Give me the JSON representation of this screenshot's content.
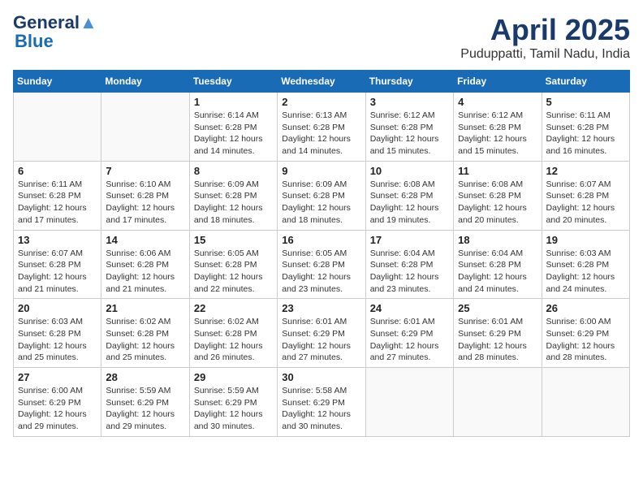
{
  "header": {
    "logo_line1": "General",
    "logo_line2": "Blue",
    "title": "April 2025",
    "location": "Puduppatti, Tamil Nadu, India"
  },
  "weekdays": [
    "Sunday",
    "Monday",
    "Tuesday",
    "Wednesday",
    "Thursday",
    "Friday",
    "Saturday"
  ],
  "weeks": [
    [
      {
        "day": "",
        "info": ""
      },
      {
        "day": "",
        "info": ""
      },
      {
        "day": "1",
        "info": "Sunrise: 6:14 AM\nSunset: 6:28 PM\nDaylight: 12 hours\nand 14 minutes."
      },
      {
        "day": "2",
        "info": "Sunrise: 6:13 AM\nSunset: 6:28 PM\nDaylight: 12 hours\nand 14 minutes."
      },
      {
        "day": "3",
        "info": "Sunrise: 6:12 AM\nSunset: 6:28 PM\nDaylight: 12 hours\nand 15 minutes."
      },
      {
        "day": "4",
        "info": "Sunrise: 6:12 AM\nSunset: 6:28 PM\nDaylight: 12 hours\nand 15 minutes."
      },
      {
        "day": "5",
        "info": "Sunrise: 6:11 AM\nSunset: 6:28 PM\nDaylight: 12 hours\nand 16 minutes."
      }
    ],
    [
      {
        "day": "6",
        "info": "Sunrise: 6:11 AM\nSunset: 6:28 PM\nDaylight: 12 hours\nand 17 minutes."
      },
      {
        "day": "7",
        "info": "Sunrise: 6:10 AM\nSunset: 6:28 PM\nDaylight: 12 hours\nand 17 minutes."
      },
      {
        "day": "8",
        "info": "Sunrise: 6:09 AM\nSunset: 6:28 PM\nDaylight: 12 hours\nand 18 minutes."
      },
      {
        "day": "9",
        "info": "Sunrise: 6:09 AM\nSunset: 6:28 PM\nDaylight: 12 hours\nand 18 minutes."
      },
      {
        "day": "10",
        "info": "Sunrise: 6:08 AM\nSunset: 6:28 PM\nDaylight: 12 hours\nand 19 minutes."
      },
      {
        "day": "11",
        "info": "Sunrise: 6:08 AM\nSunset: 6:28 PM\nDaylight: 12 hours\nand 20 minutes."
      },
      {
        "day": "12",
        "info": "Sunrise: 6:07 AM\nSunset: 6:28 PM\nDaylight: 12 hours\nand 20 minutes."
      }
    ],
    [
      {
        "day": "13",
        "info": "Sunrise: 6:07 AM\nSunset: 6:28 PM\nDaylight: 12 hours\nand 21 minutes."
      },
      {
        "day": "14",
        "info": "Sunrise: 6:06 AM\nSunset: 6:28 PM\nDaylight: 12 hours\nand 21 minutes."
      },
      {
        "day": "15",
        "info": "Sunrise: 6:05 AM\nSunset: 6:28 PM\nDaylight: 12 hours\nand 22 minutes."
      },
      {
        "day": "16",
        "info": "Sunrise: 6:05 AM\nSunset: 6:28 PM\nDaylight: 12 hours\nand 23 minutes."
      },
      {
        "day": "17",
        "info": "Sunrise: 6:04 AM\nSunset: 6:28 PM\nDaylight: 12 hours\nand 23 minutes."
      },
      {
        "day": "18",
        "info": "Sunrise: 6:04 AM\nSunset: 6:28 PM\nDaylight: 12 hours\nand 24 minutes."
      },
      {
        "day": "19",
        "info": "Sunrise: 6:03 AM\nSunset: 6:28 PM\nDaylight: 12 hours\nand 24 minutes."
      }
    ],
    [
      {
        "day": "20",
        "info": "Sunrise: 6:03 AM\nSunset: 6:28 PM\nDaylight: 12 hours\nand 25 minutes."
      },
      {
        "day": "21",
        "info": "Sunrise: 6:02 AM\nSunset: 6:28 PM\nDaylight: 12 hours\nand 25 minutes."
      },
      {
        "day": "22",
        "info": "Sunrise: 6:02 AM\nSunset: 6:28 PM\nDaylight: 12 hours\nand 26 minutes."
      },
      {
        "day": "23",
        "info": "Sunrise: 6:01 AM\nSunset: 6:29 PM\nDaylight: 12 hours\nand 27 minutes."
      },
      {
        "day": "24",
        "info": "Sunrise: 6:01 AM\nSunset: 6:29 PM\nDaylight: 12 hours\nand 27 minutes."
      },
      {
        "day": "25",
        "info": "Sunrise: 6:01 AM\nSunset: 6:29 PM\nDaylight: 12 hours\nand 28 minutes."
      },
      {
        "day": "26",
        "info": "Sunrise: 6:00 AM\nSunset: 6:29 PM\nDaylight: 12 hours\nand 28 minutes."
      }
    ],
    [
      {
        "day": "27",
        "info": "Sunrise: 6:00 AM\nSunset: 6:29 PM\nDaylight: 12 hours\nand 29 minutes."
      },
      {
        "day": "28",
        "info": "Sunrise: 5:59 AM\nSunset: 6:29 PM\nDaylight: 12 hours\nand 29 minutes."
      },
      {
        "day": "29",
        "info": "Sunrise: 5:59 AM\nSunset: 6:29 PM\nDaylight: 12 hours\nand 30 minutes."
      },
      {
        "day": "30",
        "info": "Sunrise: 5:58 AM\nSunset: 6:29 PM\nDaylight: 12 hours\nand 30 minutes."
      },
      {
        "day": "",
        "info": ""
      },
      {
        "day": "",
        "info": ""
      },
      {
        "day": "",
        "info": ""
      }
    ]
  ]
}
